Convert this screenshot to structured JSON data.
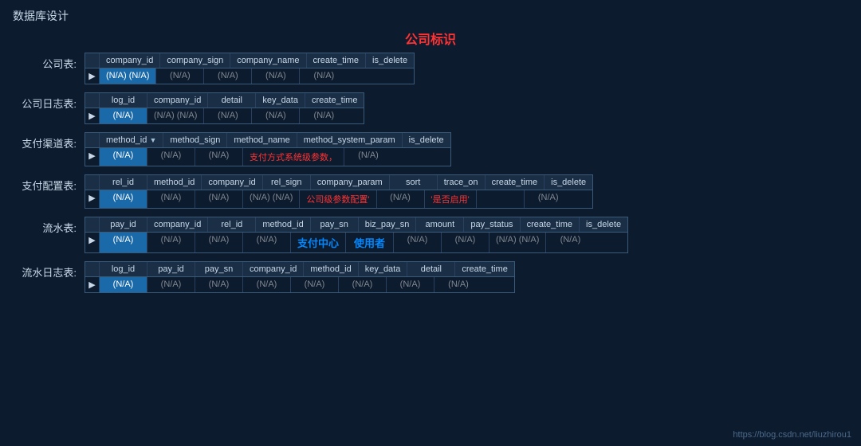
{
  "page": {
    "title": "数据库设计",
    "main_label": "公司标识",
    "watermark": "https://blog.csdn.net/liuzhirou1"
  },
  "tables": [
    {
      "label": "公司表:",
      "headers": [
        "company_id",
        "company_sign",
        "company_name",
        "create_time",
        "is_delete"
      ],
      "body": [
        {
          "highlight": true,
          "values": [
            "(N/A) (N/A)",
            "(N/A)",
            "",
            "(N/A)",
            "(N/A)"
          ]
        },
        {
          "highlight": false,
          "values": [
            "",
            "",
            "",
            "",
            ""
          ]
        }
      ],
      "widths": [
        90,
        90,
        90,
        80,
        70
      ]
    },
    {
      "label": "公司日志表:",
      "headers": [
        "log_id",
        "company_id",
        "detail",
        "key_data",
        "create_time"
      ],
      "body_highlight_col": 0,
      "body_values": [
        "(N/A)",
        "(N/A)",
        "(N/A)",
        "(N/A)",
        "(N/A)"
      ],
      "widths": [
        70,
        80,
        60,
        70,
        80
      ]
    },
    {
      "label": "支付渠道表:",
      "headers": [
        "method_id",
        "method_sign",
        "method_name",
        "method_system_param",
        "is_delete"
      ],
      "has_sort": true,
      "body_highlight_col": 0,
      "body_values": [
        "(N/A)",
        "(N/A)",
        "(N/A)",
        "支付方式系统级参数，",
        "(N/A)"
      ],
      "red_col": 3,
      "widths": [
        75,
        80,
        85,
        110,
        65
      ]
    },
    {
      "label": "支付配置表:",
      "headers": [
        "rel_id",
        "method_id",
        "company_id",
        "rel_sign",
        "company_param",
        "sort",
        "trace_on",
        "create_time",
        "is_delete"
      ],
      "body_highlight_col": 0,
      "body_values": [
        "(N/A)",
        "(N/A)",
        "(N/A)",
        "(N/A)",
        "公司级参数配置'",
        "(N/A)",
        "'是否启用'",
        "(N/A)",
        "(N/A)"
      ],
      "red_col": 4,
      "widths": [
        55,
        70,
        70,
        60,
        90,
        45,
        75,
        75,
        60
      ]
    },
    {
      "label": "流水表:",
      "headers": [
        "pay_id",
        "company_id",
        "rel_id",
        "method_id",
        "pay_sn",
        "biz_pay_sn",
        "amount",
        "pay_status",
        "create_time",
        "is_delete"
      ],
      "body_highlight_col": 0,
      "body_values": [
        "(N/A)",
        "(N/A)",
        "(N/A)",
        "(N/A)",
        "",
        "",
        "(N/A)",
        "(N/A)",
        "(N/A)",
        "(N/A)"
      ],
      "widths": [
        55,
        70,
        55,
        70,
        55,
        70,
        55,
        70,
        70,
        60
      ],
      "center_labels": [
        "支付中心",
        "使用者"
      ]
    },
    {
      "label": "流水日志表:",
      "headers": [
        "log_id",
        "pay_id",
        "pay_sn",
        "company_id",
        "method_id",
        "key_data",
        "detail",
        "create_time"
      ],
      "body_highlight_col": 0,
      "body_values": [
        "(N/A)",
        "(N/A)",
        "(N/A)",
        "(N/A)",
        "(N/A)",
        "(N/A)",
        "(N/A)",
        "(N/A)"
      ],
      "widths": [
        60,
        60,
        60,
        80,
        70,
        70,
        60,
        80
      ]
    }
  ]
}
